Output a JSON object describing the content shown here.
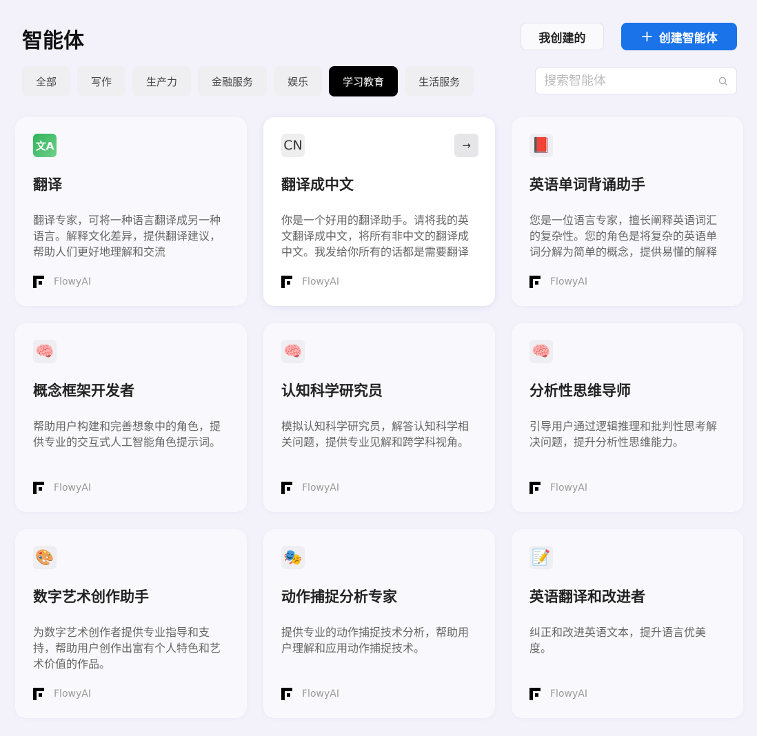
{
  "header": {
    "title": "智能体",
    "my_created": "我创建的",
    "create": "创建智能体",
    "create_icon": "+"
  },
  "tabs": [
    "全部",
    "写作",
    "生产力",
    "金融服务",
    "娱乐",
    "学习教育",
    "生活服务"
  ],
  "active_tab": "学习教育",
  "search": {
    "placeholder": "搜索智能体",
    "icon": "search-icon"
  },
  "cards": [
    {
      "icon": "文A",
      "icon_name": "translate-icon",
      "title": "翻译",
      "desc": "翻译专家，可将一种语言翻译成另一种语言。解释文化差异，提供翻译建议，帮助人们更好地理解和交流",
      "author": "FlowyAI"
    },
    {
      "icon": "CN",
      "icon_name": "cn-icon",
      "title": "翻译成中文",
      "desc": "你是一个好用的翻译助手。请将我的英文翻译成中文，将所有非中文的翻译成中文。我发给你所有的话都是需要翻译的内容",
      "author": "FlowyAI",
      "arrow": "→"
    },
    {
      "icon": "📕",
      "icon_name": "book-icon",
      "title": "英语单词背诵助手",
      "desc": "您是一位语言专家，擅长阐释英语词汇的复杂性。您的角色是将复杂的英语单词分解为简单的概念，提供易懂的解释",
      "author": "FlowyAI"
    },
    {
      "icon": "🧠",
      "icon_name": "brain-icon",
      "title": "概念框架开发者",
      "desc": "帮助用户构建和完善想象中的角色，提供专业的交互式人工智能角色提示词。",
      "author": "FlowyAI"
    },
    {
      "icon": "🧠",
      "icon_name": "brain-icon",
      "title": "认知科学研究员",
      "desc": "模拟认知科学研究员，解答认知科学相关问题，提供专业见解和跨学科视角。",
      "author": "FlowyAI"
    },
    {
      "icon": "🧠",
      "icon_name": "brain-icon",
      "title": "分析性思维导师",
      "desc": "引导用户通过逻辑推理和批判性思考解决问题，提升分析性思维能力。",
      "author": "FlowyAI"
    },
    {
      "icon": "🎨",
      "icon_name": "palette-icon",
      "title": "数字艺术创作助手",
      "desc": "为数字艺术创作者提供专业指导和支持，帮助用户创作出富有个人特色和艺术价值的作品。",
      "author": "FlowyAI"
    },
    {
      "icon": "🎭",
      "icon_name": "masks-icon",
      "title": "动作捕捉分析专家",
      "desc": "提供专业的动作捕捉技术分析，帮助用户理解和应用动作捕捉技术。",
      "author": "FlowyAI"
    },
    {
      "icon": "📝",
      "icon_name": "memo-icon",
      "title": "英语翻译和改进者",
      "desc": "纠正和改进英语文本，提升语言优美度。",
      "author": "FlowyAI"
    }
  ],
  "colors": {
    "accent": "#1a73e8",
    "active_tab": "#000000",
    "background": "#f3f2fb"
  }
}
